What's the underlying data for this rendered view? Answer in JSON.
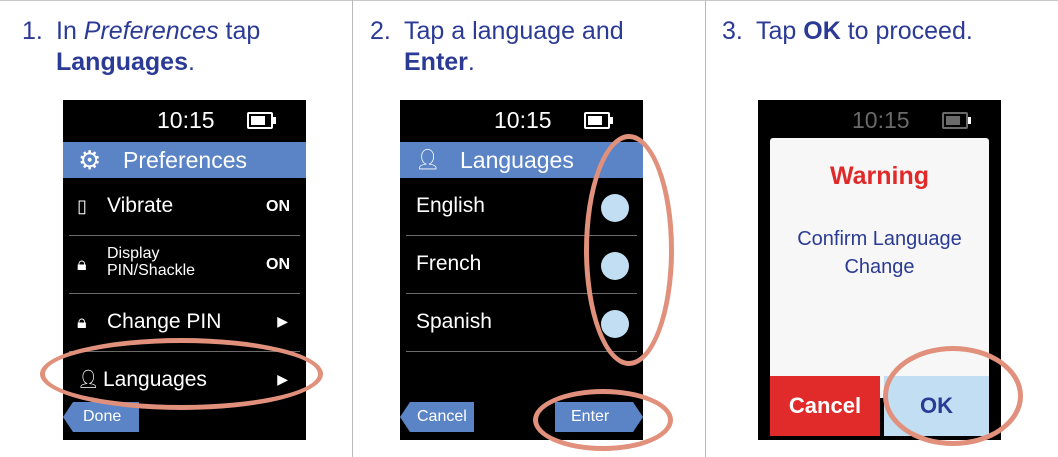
{
  "steps": [
    {
      "number": "1.",
      "pre": "In ",
      "italic": "Preferences",
      "post": " tap",
      "bold": "Languages",
      "after": "."
    },
    {
      "number": "2.",
      "pre": "Tap a language and",
      "bold": "Enter",
      "after": "."
    },
    {
      "number": "3.",
      "pre": "Tap ",
      "bold": "OK",
      "after": " to proceed."
    }
  ],
  "phone1": {
    "time": "10:15",
    "title": "Preferences",
    "title_icon": "gear-icon",
    "rows": [
      {
        "label": "Vibrate",
        "value": "ON",
        "icon": "phone-icon"
      },
      {
        "label_line1": "Display",
        "label_line2": "PIN/Shackle",
        "value": "ON",
        "icon": "lock-icon"
      },
      {
        "label": "Change PIN",
        "arrow": "▶",
        "icon": "lock-keypad-icon"
      },
      {
        "label": "Languages",
        "arrow": "▶",
        "icon": "speech-person-icon"
      }
    ],
    "done_label": "Done"
  },
  "phone2": {
    "time": "10:15",
    "title": "Languages",
    "title_icon": "speech-person-icon",
    "languages": [
      "English",
      "French",
      "Spanish"
    ],
    "cancel_label": "Cancel",
    "enter_label": "Enter"
  },
  "phone3": {
    "time": "10:15",
    "dialog_title": "Warning",
    "dialog_message_line1": "Confirm Language",
    "dialog_message_line2": "Change",
    "cancel_label": "Cancel",
    "ok_label": "OK"
  },
  "colors": {
    "accent_blue": "#5b84c6",
    "text_blue": "#2b3a95",
    "warning_red": "#e02a2a",
    "highlight": "#e0907b",
    "radio": "#c2def2"
  }
}
